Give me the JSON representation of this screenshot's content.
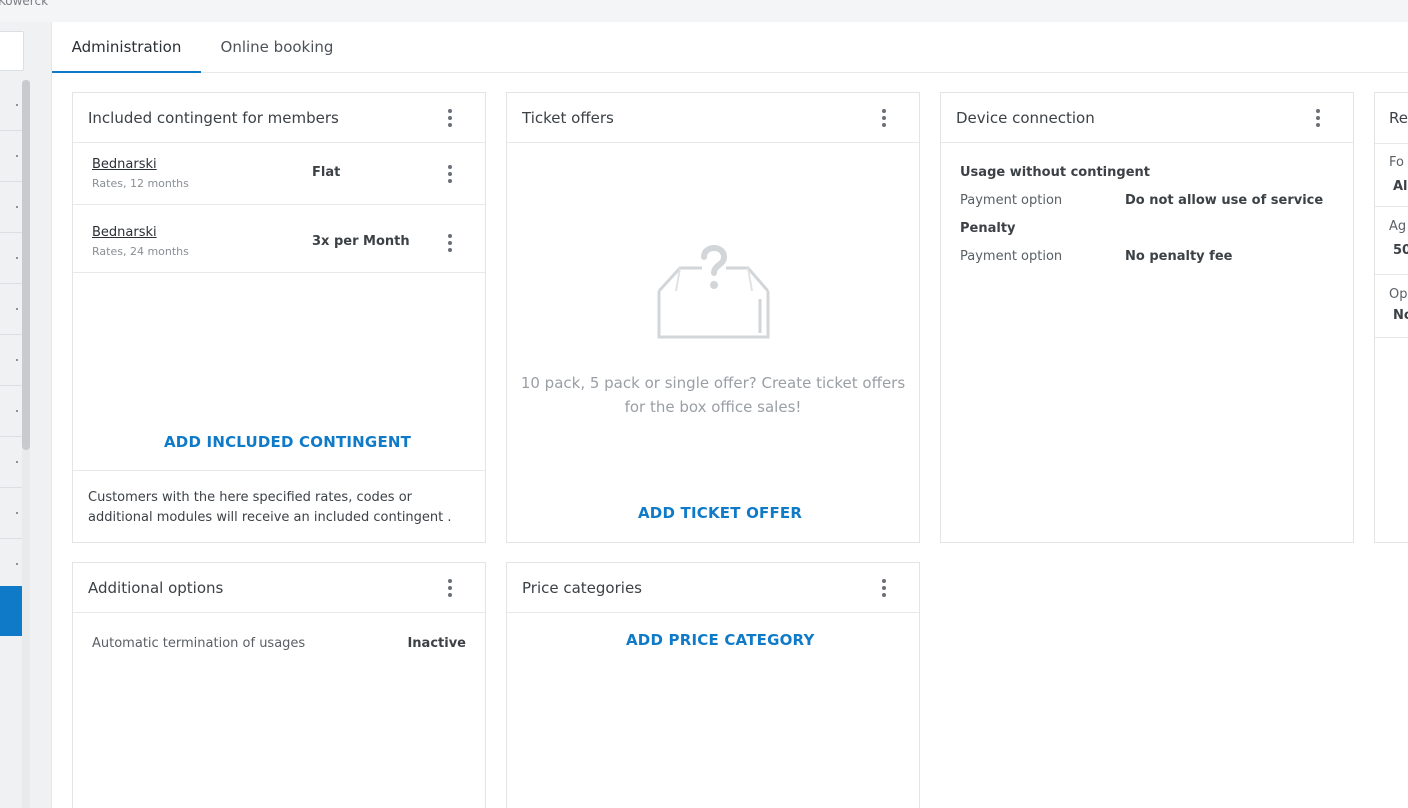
{
  "topbar": {
    "crumb": "Kowerck"
  },
  "tabs": [
    {
      "label": "Administration",
      "active": true
    },
    {
      "label": "Online booking",
      "active": false
    }
  ],
  "cards": {
    "included": {
      "title": "Included contingent for members",
      "rows": [
        {
          "name": "Bednarski",
          "sub": "Rates, 12 months",
          "value": "Flat"
        },
        {
          "name": "Bednarski",
          "sub": "Rates, 24 months",
          "value": "3x per Month"
        }
      ],
      "add_label": "ADD INCLUDED CONTINGENT",
      "footnote": "Customers with the here specified rates, codes or additional modules will receive an included contingent ."
    },
    "tickets": {
      "title": "Ticket offers",
      "empty_icon": "empty-box-question-icon",
      "empty_text": "10 pack, 5 pack or single offer? Create ticket offers for the box office sales!",
      "add_label": "ADD TICKET OFFER"
    },
    "device": {
      "title": "Device connection",
      "section1": "Usage without contingent",
      "payment_label_1": "Payment option",
      "payment_value_1": "Do not allow use of service",
      "section2": "Penalty",
      "payment_label_2": "Payment option",
      "payment_value_2": "No penalty fee"
    },
    "partial": {
      "title": "Re",
      "rows": [
        {
          "label": "Fo",
          "value": "Al"
        },
        {
          "label": "Ag",
          "value": "50"
        },
        {
          "label": "Op",
          "value": "No"
        }
      ]
    },
    "additional": {
      "title": "Additional options",
      "option_label": "Automatic termination of usages",
      "option_value": "Inactive"
    },
    "price": {
      "title": "Price categories",
      "add_label": "ADD PRICE CATEGORY"
    }
  },
  "colors": {
    "accent": "#0f7ac8"
  }
}
